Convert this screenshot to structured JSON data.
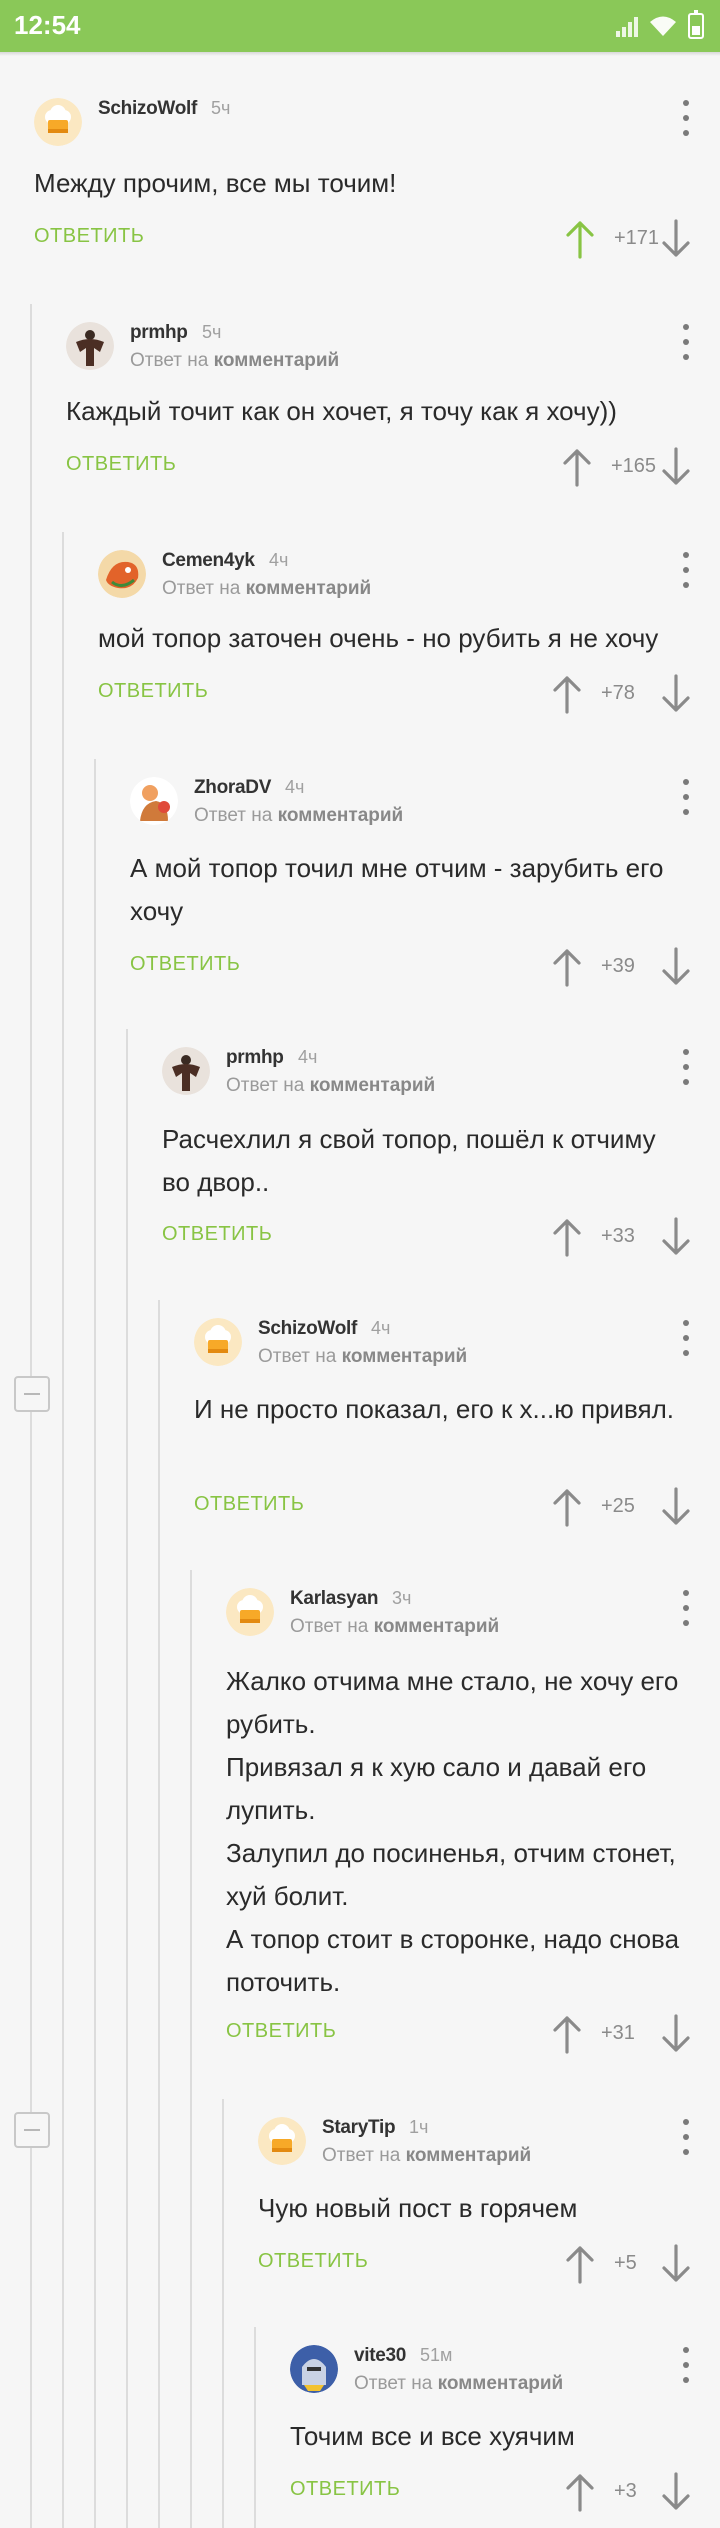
{
  "status_bar": {
    "time": "12:54"
  },
  "ui": {
    "reply_label": "ОТВЕТИТЬ",
    "reply_prefix": "Ответ на ",
    "reply_target": "комментарий"
  },
  "colors": {
    "accent": "#88c444",
    "status_bar": "#8ac858",
    "upvoted": "#88c444"
  },
  "comments": [
    {
      "author": "SchizoWolf",
      "time": "5ч",
      "text": "Между прочим, все мы точим!",
      "score": "+171",
      "upvoted": true,
      "avatar": "chef-hat-icon",
      "reply": false
    },
    {
      "author": "prmhp",
      "time": "5ч",
      "text": "Каждый точит как он хочет, я точу как я хочу))",
      "score": "+165",
      "upvoted": false,
      "avatar": "bodybuilder-photo",
      "reply": true
    },
    {
      "author": "Cemen4yk",
      "time": "4ч",
      "text": "мой топор заточен очень - но рубить я не хочу",
      "score": "+78",
      "upvoted": false,
      "avatar": "dragon-icon",
      "reply": true
    },
    {
      "author": "ZhoraDV",
      "time": "4ч",
      "text": "А мой топор точил мне отчим - зарубить его хочу",
      "score": "+39",
      "upvoted": false,
      "avatar": "cartoon-character-icon",
      "reply": true
    },
    {
      "author": "prmhp",
      "time": "4ч",
      "text": "Расчехлил я свой топор, пошёл к отчиму во двор..",
      "score": "+33",
      "upvoted": false,
      "avatar": "bodybuilder-photo",
      "reply": true
    },
    {
      "author": "SchizoWolf",
      "time": "4ч",
      "text": "И не просто показал, его к х...ю привял.",
      "score": "+25",
      "upvoted": false,
      "avatar": "chef-hat-icon",
      "reply": true
    },
    {
      "author": "Karlasyan",
      "time": "3ч",
      "text": "Жалко отчима мне стало, не хочу его рубить.\nПривязал я к хую сало и давай его лупить.\nЗалупил до посиненья, отчим стонет, хуй болит.\nА топор стоит в сторонке, надо снова поточить.",
      "score": "+31",
      "upvoted": false,
      "avatar": "chef-hat-icon",
      "reply": true
    },
    {
      "author": "StaryTip",
      "time": "1ч",
      "text": "Чую новый пост в горячем",
      "score": "+5",
      "upvoted": false,
      "avatar": "chef-hat-icon",
      "reply": true
    },
    {
      "author": "vite30",
      "time": "51м",
      "text": "Точим все и все хуячим",
      "score": "+3",
      "upvoted": false,
      "avatar": "knight-icon",
      "reply": true
    }
  ]
}
